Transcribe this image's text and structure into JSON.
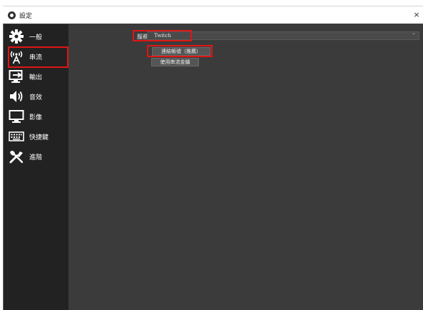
{
  "window": {
    "title": "設定",
    "close_glyph": "×"
  },
  "sidebar": {
    "items": [
      {
        "label": "一般",
        "icon": "gear-icon"
      },
      {
        "label": "串流",
        "icon": "broadcast-antenna-icon"
      },
      {
        "label": "輸出",
        "icon": "output-arrow-icon"
      },
      {
        "label": "音效",
        "icon": "speaker-icon"
      },
      {
        "label": "影像",
        "icon": "monitor-icon"
      },
      {
        "label": "快捷鍵",
        "icon": "keyboard-icon"
      },
      {
        "label": "進階",
        "icon": "tools-icon"
      }
    ],
    "selected": "串流"
  },
  "stream": {
    "service_label": "服務",
    "service_value": "Twitch",
    "connect_button": "連結帳號（推薦）",
    "stream_key_button": "使用串流金鑰"
  },
  "colors": {
    "highlight": "#e01515",
    "sidebar_bg": "#222222",
    "content_bg": "#3b3b3b"
  }
}
